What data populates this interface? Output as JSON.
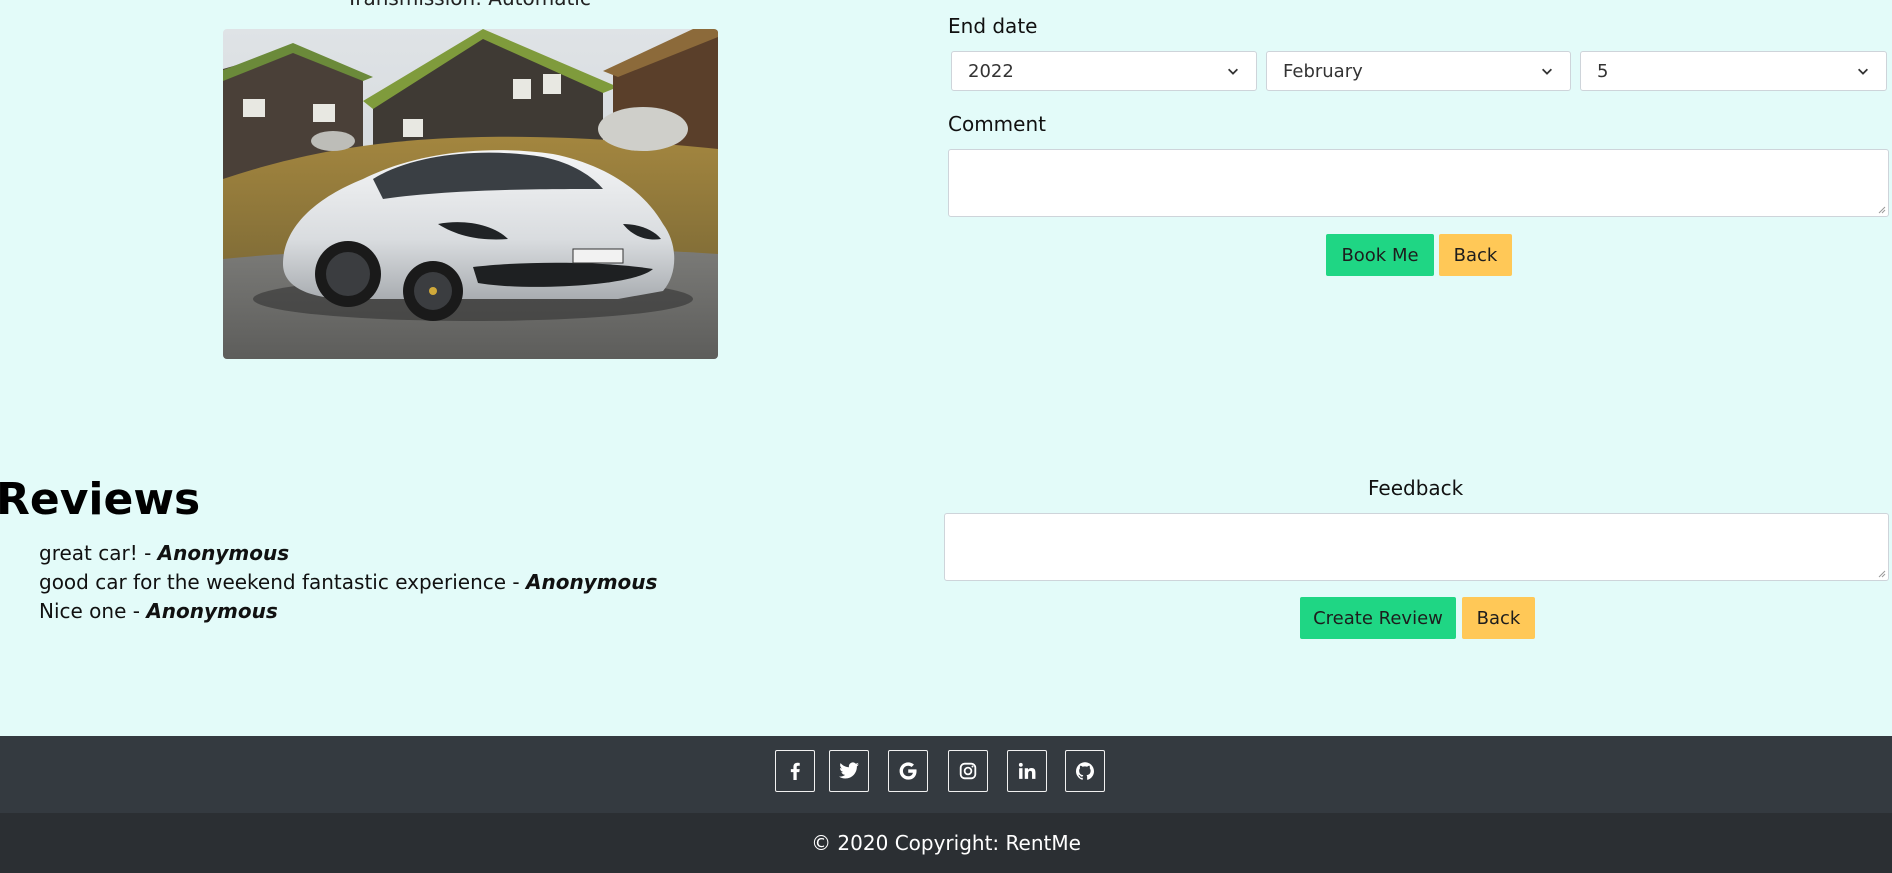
{
  "car": {
    "caption": "Transmission: Automatic"
  },
  "booking": {
    "end_date_label": "End date",
    "year": "2022",
    "month": "February",
    "day": "5",
    "comment_label": "Comment",
    "comment_value": "",
    "book_label": "Book Me",
    "back_label": "Back"
  },
  "reviews": {
    "title": "Reviews",
    "items": [
      {
        "text": "great car! - ",
        "author": "Anonymous"
      },
      {
        "text": "good car for the weekend fantastic experience - ",
        "author": "Anonymous"
      },
      {
        "text": "Nice one - ",
        "author": "Anonymous"
      }
    ]
  },
  "feedback": {
    "label": "Feedback",
    "value": "",
    "create_label": "Create Review",
    "back_label": "Back"
  },
  "footer": {
    "social_icons": [
      "facebook-icon",
      "twitter-icon",
      "google-icon",
      "instagram-icon",
      "linkedin-icon",
      "github-icon"
    ],
    "copyright": "© 2020 Copyright: RentMe"
  },
  "colors": {
    "background": "#e3fbf9",
    "primary_green": "#1fd684",
    "warning_yellow": "#ffc857",
    "footer_dark": "#343a40"
  }
}
